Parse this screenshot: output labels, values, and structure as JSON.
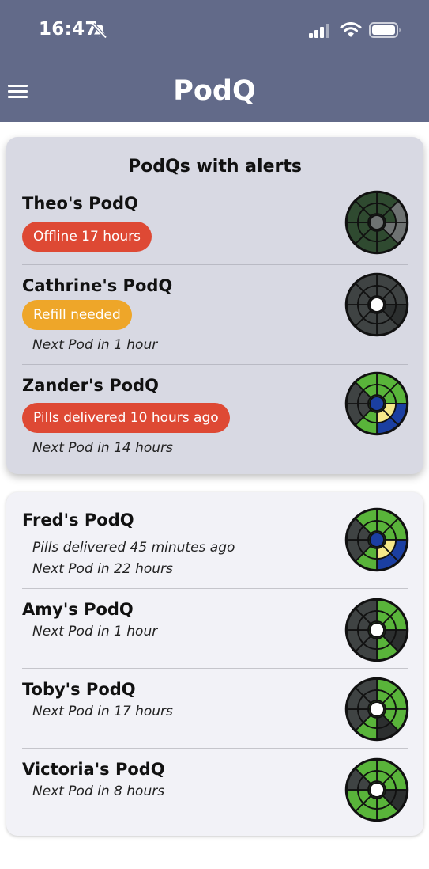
{
  "status_bar": {
    "time": "16:47"
  },
  "header": {
    "title": "PodQ"
  },
  "alerts": {
    "title": "PodQs with alerts",
    "items": [
      {
        "name": "Theo's PodQ",
        "badge": "Offline 17 hours",
        "badge_color": "#de4934"
      },
      {
        "name": "Cathrine's PodQ",
        "badge": "Refill needed",
        "badge_color": "#eea629",
        "next": "Next Pod in 1 hour"
      },
      {
        "name": "Zander's PodQ",
        "badge": "Pills delivered 10 hours ago",
        "badge_color": "#de4934",
        "next": "Next Pod in 14 hours"
      }
    ]
  },
  "podqs": {
    "items": [
      {
        "name": "Fred's PodQ",
        "delivered": "Pills delivered 45 minutes ago",
        "next": "Next Pod in 22 hours"
      },
      {
        "name": "Amy's PodQ",
        "next": "Next Pod in 1 hour"
      },
      {
        "name": "Toby's PodQ",
        "next": "Next Pod in 17 hours"
      },
      {
        "name": "Victoria's PodQ",
        "next": "Next Pod in 8 hours"
      }
    ]
  },
  "colors": {
    "header": "#626a89",
    "alert_red": "#de4934",
    "alert_orange": "#eea629",
    "dial_green": "#59b43a",
    "dial_dark": "#3f4343",
    "dial_yellow": "#f6e889",
    "dial_blue": "#1b3fa1"
  },
  "icons": [
    "menu-icon",
    "bell-slash-icon",
    "cellular-signal-icon",
    "wifi-icon",
    "battery-icon",
    "pod-dial-icon"
  ]
}
